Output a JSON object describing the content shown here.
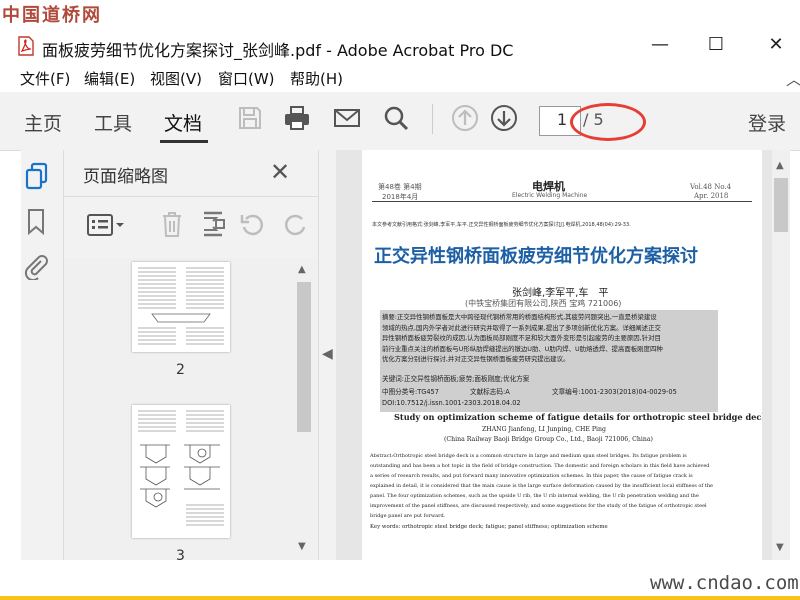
{
  "watermark_top": "中国道桥网",
  "watermark_bottom": "www.cndao.com",
  "window": {
    "title": "面板疲劳细节优化方案探讨_张剑峰.pdf - Adobe Acrobat Pro DC",
    "minimize": "—",
    "maximize": "☐",
    "close": "✕"
  },
  "menu": [
    {
      "label": "文件(F)"
    },
    {
      "label": "编辑(E)"
    },
    {
      "label": "视图(V)"
    },
    {
      "label": "窗口(W)"
    },
    {
      "label": "帮助(H)"
    }
  ],
  "toolbar": {
    "tabs": [
      "主页",
      "工具",
      "文档"
    ],
    "active_tab": "文档",
    "page_current": "1",
    "page_total": "/ 5",
    "login": "登录",
    "icons": [
      "save-icon",
      "print-icon",
      "email-icon",
      "search-icon",
      "prev-page-icon",
      "next-page-icon"
    ]
  },
  "thumbnails": {
    "title": "页面缩略图",
    "close": "✕",
    "pages": [
      "2",
      "3"
    ]
  },
  "paper": {
    "header_left": "第48卷 第4期",
    "header_left2": "2018年4月",
    "journal": "电焊机",
    "journal_en": "Electric Welding Machine",
    "header_right": "Vol.48 No.4",
    "header_right2": "Apr. 2018",
    "citation": "本文参考文献引用格式:张剑峰,李军平,车平.正交异性钢桥面板疲劳细节优化方案探讨[J].电焊机,2018,48(04):29-33.",
    "title": "正交异性钢桥面板疲劳细节优化方案探讨",
    "authors": "张剑峰,李军平,车　平",
    "affiliation": "(中铁宝桥集团有限公司,陕西 宝鸡 721006)",
    "abstract_lines": [
      "摘要:正交异性钢桥面板是大中跨径现代钢桥常用的桥面结构形式,其疲劳问题突出,一直是桥梁建设",
      "领域的热点,国内外学者对此进行研究并取得了一系列成果,提出了多项创新优化方案。详细阐述正交",
      "异性钢桥面板疲劳裂纹的成因,认为面板局部刚度不足和较大面外变形是引起疲劳的主要原因,针对目",
      "前行业重点关注的桥面板与U形纵肋焊缝提出的镦边U肋、U肋内焊、U肋熔透焊、提高面板刚度四种",
      "优化方案分别进行探讨,并对正交异性钢桥面板疲劳研究提出建议。"
    ],
    "keywords": "关键词:正交异性钢桥面板;疲劳;面板刚度;优化方案",
    "clc": "中图分类号:TG457",
    "doc_code": "文献标志码:A",
    "article_no": "文章编号:1001-2303(2018)04-0029-05",
    "doi": "DOI:10.7512/j.issn.1001-2303.2018.04.02",
    "en_title": "Study on optimization scheme of fatigue details for orthotropic steel bridge deck",
    "en_authors": "ZHANG Jianfeng, LI Junping, CHE Ping",
    "en_affiliation": "(China Railway Baoji Bridge Group Co., Ltd., Baoji 721006, China)",
    "en_abstract_lines": [
      "Abstract:Orthotropic steel bridge deck is a common structure in large and medium span steel bridges. Its fatigue problem is",
      "outstanding and has been a hot topic in the field of bridge construction. The domestic and foreign scholars in this field have achieved",
      "a series of research results, and put forward many innovative optimization schemes. In this paper, the cause of fatigue crack is",
      "explained in detail, it is considered that the main cause is the large surface deformation caused by the insufficient local stiffness of the",
      "panel. The four optimization schemes, such as the upside U rib, the U rib internal welding, the U rib penetration welding and the",
      "improvement of the panel stiffness, are discussed respectively, and some suggestions for the study of the fatigue of orthotropic steel",
      "bridge panel are put forward."
    ],
    "en_keywords": "Key words: orthotropic steel bridge deck; fatigue; panel stiffness; optimization scheme"
  }
}
